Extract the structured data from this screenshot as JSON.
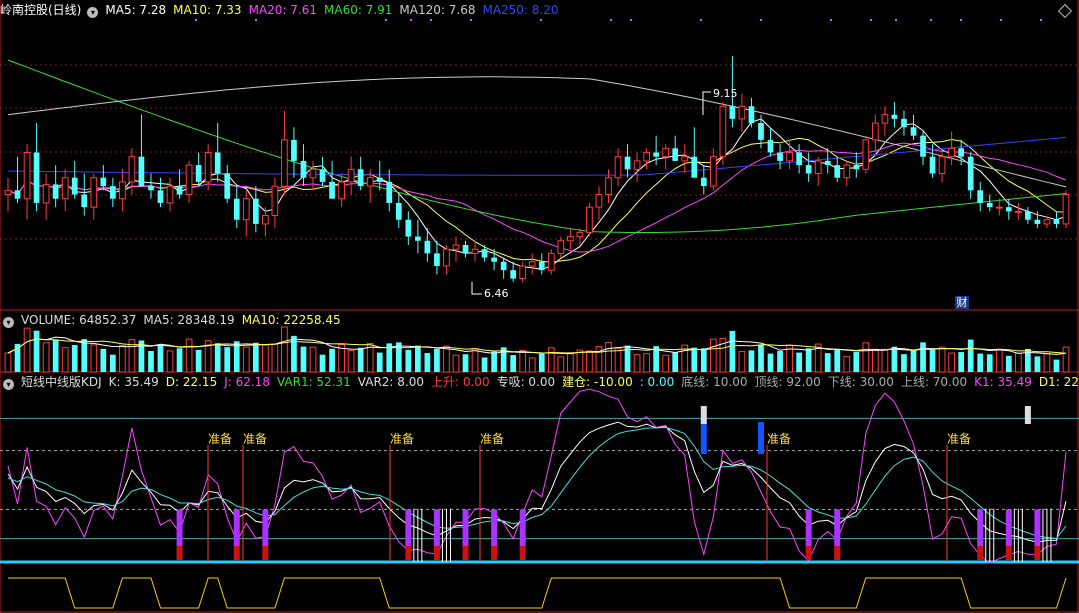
{
  "colors": {
    "up": "#ff3b3b",
    "down": "#54ffff",
    "ma5": "#ffffff",
    "ma10": "#ffff55",
    "ma20": "#ff44ff",
    "ma60": "#33dd33",
    "ma120": "#cccccc",
    "ma250": "#3344ff",
    "grid": "#8a1c1c",
    "panelBorder": "#c02020"
  },
  "main_panel": {
    "title": "岭南控股(日线)",
    "toggle_icon": "chevron-circle-icon",
    "ma": [
      {
        "label": "MA5: 7.28",
        "color": "#ffffff"
      },
      {
        "label": "MA10: 7.33",
        "color": "#ffff55"
      },
      {
        "label": "MA20: 7.61",
        "color": "#ff44ff"
      },
      {
        "label": "MA60: 7.91",
        "color": "#33dd33"
      },
      {
        "label": "MA120: 7.68",
        "color": "#cccccc"
      },
      {
        "label": "MA250: 8.20",
        "color": "#3344ff"
      }
    ],
    "high_label": "9.15",
    "low_label": "6.46",
    "cai_badge": "财"
  },
  "volume_panel": {
    "labels": [
      {
        "label": "VOLUME: 64852.37",
        "color": "#dddddd"
      },
      {
        "label": "MA5: 28348.19",
        "color": "#dddddd"
      },
      {
        "label": "MA10: 22258.45",
        "color": "#ffff55"
      }
    ]
  },
  "indicator_panel": {
    "labels": [
      {
        "label": "短线中线版KDJ",
        "color": "#dddddd"
      },
      {
        "label": "K: 35.49",
        "color": "#dddddd"
      },
      {
        "label": "D: 22.15",
        "color": "#ffff55"
      },
      {
        "label": "J: 62.18",
        "color": "#ff44ff"
      },
      {
        "label": "VAR1: 52.31",
        "color": "#33dd33"
      },
      {
        "label": "VAR2: 8.00",
        "color": "#dddddd"
      },
      {
        "label": "上升: 0.00",
        "color": "#ff3b3b"
      },
      {
        "label": "专吸: 0.00",
        "color": "#dddddd"
      },
      {
        "label": "建仓: -10.00",
        "color": "#ffff55"
      },
      {
        "label": ": 0.00",
        "color": "#54ffff"
      },
      {
        "label": "底线: 10.00",
        "color": "#aaaaaa"
      },
      {
        "label": "顶线: 92.00",
        "color": "#aaaaaa"
      },
      {
        "label": "下线: 30.00",
        "color": "#aaaaaa"
      },
      {
        "label": "上线: 70.00",
        "color": "#aaaaaa"
      },
      {
        "label": "K1: 35.49",
        "color": "#ff44ff"
      },
      {
        "label": "D1: 22.15",
        "color": "#ffff55"
      }
    ],
    "signal_label": "准备",
    "signal_positions": [
      8,
      10,
      24,
      30,
      48,
      62
    ]
  },
  "chart_data": {
    "type": "candlestick",
    "candles": [
      [
        7.5,
        7.7,
        7.3,
        7.55
      ],
      [
        7.55,
        7.95,
        7.4,
        7.45
      ],
      [
        7.45,
        8.1,
        7.2,
        8.0
      ],
      [
        8.0,
        8.35,
        7.3,
        7.4
      ],
      [
        7.4,
        7.75,
        7.2,
        7.62
      ],
      [
        7.62,
        7.85,
        7.35,
        7.45
      ],
      [
        7.45,
        7.8,
        7.3,
        7.7
      ],
      [
        7.7,
        7.9,
        7.45,
        7.5
      ],
      [
        7.5,
        7.75,
        7.25,
        7.35
      ],
      [
        7.35,
        7.75,
        7.2,
        7.7
      ],
      [
        7.7,
        7.85,
        7.55,
        7.6
      ],
      [
        7.6,
        7.7,
        7.35,
        7.45
      ],
      [
        7.45,
        7.8,
        7.3,
        7.65
      ],
      [
        7.65,
        8.05,
        7.5,
        7.95
      ],
      [
        7.95,
        8.45,
        7.7,
        7.6
      ],
      [
        7.6,
        7.75,
        7.45,
        7.55
      ],
      [
        7.55,
        7.7,
        7.35,
        7.4
      ],
      [
        7.4,
        7.7,
        7.3,
        7.6
      ],
      [
        7.6,
        7.8,
        7.45,
        7.5
      ],
      [
        7.5,
        7.9,
        7.4,
        7.85
      ],
      [
        7.85,
        8.0,
        7.6,
        7.65
      ],
      [
        7.65,
        8.1,
        7.55,
        8.0
      ],
      [
        8.0,
        8.35,
        7.65,
        7.75
      ],
      [
        7.75,
        7.85,
        7.4,
        7.45
      ],
      [
        7.45,
        7.6,
        7.1,
        7.2
      ],
      [
        7.2,
        7.55,
        7.0,
        7.45
      ],
      [
        7.45,
        7.6,
        7.05,
        7.15
      ],
      [
        7.15,
        7.35,
        7.0,
        7.25
      ],
      [
        7.25,
        7.7,
        7.1,
        7.6
      ],
      [
        7.6,
        8.5,
        7.5,
        8.15
      ],
      [
        8.15,
        8.3,
        7.7,
        7.9
      ],
      [
        7.9,
        8.1,
        7.6,
        7.7
      ],
      [
        7.7,
        7.9,
        7.55,
        7.8
      ],
      [
        7.8,
        7.95,
        7.6,
        7.65
      ],
      [
        7.65,
        7.9,
        7.5,
        7.45
      ],
      [
        7.45,
        7.75,
        7.35,
        7.65
      ],
      [
        7.65,
        7.95,
        7.5,
        7.8
      ],
      [
        7.8,
        7.95,
        7.55,
        7.6
      ],
      [
        7.6,
        7.8,
        7.4,
        7.7
      ],
      [
        7.7,
        7.9,
        7.55,
        7.65
      ],
      [
        7.65,
        7.8,
        7.3,
        7.4
      ],
      [
        7.4,
        7.5,
        7.1,
        7.2
      ],
      [
        7.2,
        7.3,
        6.9,
        7.0
      ],
      [
        7.0,
        7.2,
        6.8,
        6.95
      ],
      [
        6.95,
        7.1,
        6.7,
        6.8
      ],
      [
        6.8,
        6.95,
        6.55,
        6.65
      ],
      [
        6.65,
        6.9,
        6.55,
        6.85
      ],
      [
        6.85,
        7.0,
        6.7,
        6.9
      ],
      [
        6.9,
        6.95,
        6.75,
        6.8
      ],
      [
        6.8,
        6.95,
        6.7,
        6.85
      ],
      [
        6.85,
        6.9,
        6.7,
        6.75
      ],
      [
        6.75,
        6.85,
        6.6,
        6.7
      ],
      [
        6.7,
        6.75,
        6.5,
        6.6
      ],
      [
        6.6,
        6.7,
        6.46,
        6.5
      ],
      [
        6.5,
        6.7,
        6.45,
        6.65
      ],
      [
        6.65,
        6.8,
        6.55,
        6.7
      ],
      [
        6.7,
        6.8,
        6.55,
        6.6
      ],
      [
        6.6,
        6.85,
        6.55,
        6.8
      ],
      [
        6.8,
        7.0,
        6.75,
        6.95
      ],
      [
        6.95,
        7.1,
        6.85,
        7.0
      ],
      [
        7.0,
        7.1,
        6.9,
        7.05
      ],
      [
        7.05,
        7.4,
        7.0,
        7.35
      ],
      [
        7.35,
        7.6,
        7.2,
        7.5
      ],
      [
        7.5,
        7.8,
        7.4,
        7.7
      ],
      [
        7.7,
        8.05,
        7.6,
        7.95
      ],
      [
        7.95,
        8.1,
        7.7,
        7.8
      ],
      [
        7.8,
        8.0,
        7.65,
        7.9
      ],
      [
        7.9,
        8.05,
        7.8,
        8.0
      ],
      [
        8.0,
        8.2,
        7.85,
        7.95
      ],
      [
        7.95,
        8.1,
        7.8,
        8.05
      ],
      [
        8.05,
        8.2,
        7.95,
        7.9
      ],
      [
        7.9,
        8.1,
        7.75,
        7.95
      ],
      [
        7.95,
        8.3,
        7.8,
        7.7
      ],
      [
        7.7,
        7.85,
        7.5,
        7.6
      ],
      [
        7.6,
        8.05,
        7.55,
        7.95
      ],
      [
        7.95,
        8.6,
        7.85,
        8.55
      ],
      [
        8.55,
        9.15,
        8.3,
        8.4
      ],
      [
        8.4,
        8.7,
        8.25,
        8.55
      ],
      [
        8.55,
        8.65,
        8.3,
        8.35
      ],
      [
        8.35,
        8.45,
        8.05,
        8.15
      ],
      [
        8.15,
        8.3,
        7.95,
        8.0
      ],
      [
        8.0,
        8.1,
        7.8,
        7.9
      ],
      [
        7.9,
        8.15,
        7.8,
        8.0
      ],
      [
        8.0,
        8.1,
        7.75,
        7.85
      ],
      [
        7.85,
        8.0,
        7.65,
        7.75
      ],
      [
        7.75,
        7.95,
        7.6,
        7.9
      ],
      [
        7.9,
        8.05,
        7.75,
        7.85
      ],
      [
        7.85,
        7.95,
        7.65,
        7.7
      ],
      [
        7.7,
        7.9,
        7.6,
        7.85
      ],
      [
        7.85,
        8.0,
        7.7,
        7.8
      ],
      [
        7.8,
        8.2,
        7.75,
        8.15
      ],
      [
        8.15,
        8.45,
        8.0,
        8.35
      ],
      [
        8.35,
        8.55,
        8.2,
        8.45
      ],
      [
        8.45,
        8.6,
        8.3,
        8.4
      ],
      [
        8.4,
        8.5,
        8.2,
        8.3
      ],
      [
        8.3,
        8.45,
        8.15,
        8.2
      ],
      [
        8.2,
        8.25,
        7.85,
        7.95
      ],
      [
        7.95,
        8.1,
        7.7,
        7.75
      ],
      [
        7.75,
        8.0,
        7.65,
        7.95
      ],
      [
        7.95,
        8.25,
        7.85,
        8.05
      ],
      [
        8.05,
        8.15,
        7.85,
        7.95
      ],
      [
        7.95,
        8.0,
        7.45,
        7.55
      ],
      [
        7.55,
        7.65,
        7.3,
        7.4
      ],
      [
        7.4,
        7.5,
        7.3,
        7.35
      ],
      [
        7.35,
        7.45,
        7.25,
        7.35
      ],
      [
        7.35,
        7.45,
        7.2,
        7.3
      ],
      [
        7.3,
        7.4,
        7.2,
        7.3
      ],
      [
        7.3,
        7.35,
        7.15,
        7.2
      ],
      [
        7.2,
        7.3,
        7.1,
        7.15
      ],
      [
        7.15,
        7.25,
        7.1,
        7.2
      ],
      [
        7.2,
        7.3,
        7.1,
        7.15
      ],
      [
        7.15,
        7.55,
        7.1,
        7.5
      ]
    ]
  }
}
